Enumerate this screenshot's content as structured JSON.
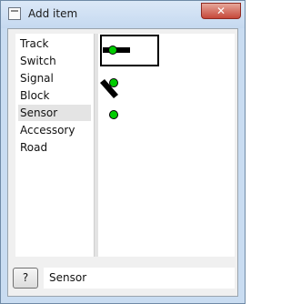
{
  "window": {
    "title": "Add item",
    "close_glyph": "✕"
  },
  "categories": {
    "items": [
      {
        "label": "Track"
      },
      {
        "label": "Switch"
      },
      {
        "label": "Signal"
      },
      {
        "label": "Block"
      },
      {
        "label": "Sensor"
      },
      {
        "label": "Accessory"
      },
      {
        "label": "Road"
      }
    ],
    "selected": "Sensor"
  },
  "preview": {
    "icons": [
      "track-sensor-icon",
      "diagonal-track-sensor-icon",
      "sensor-dot-icon"
    ],
    "sensor_color": "#00cc00"
  },
  "bottom": {
    "help_label": "?",
    "selected_label": "Sensor"
  }
}
